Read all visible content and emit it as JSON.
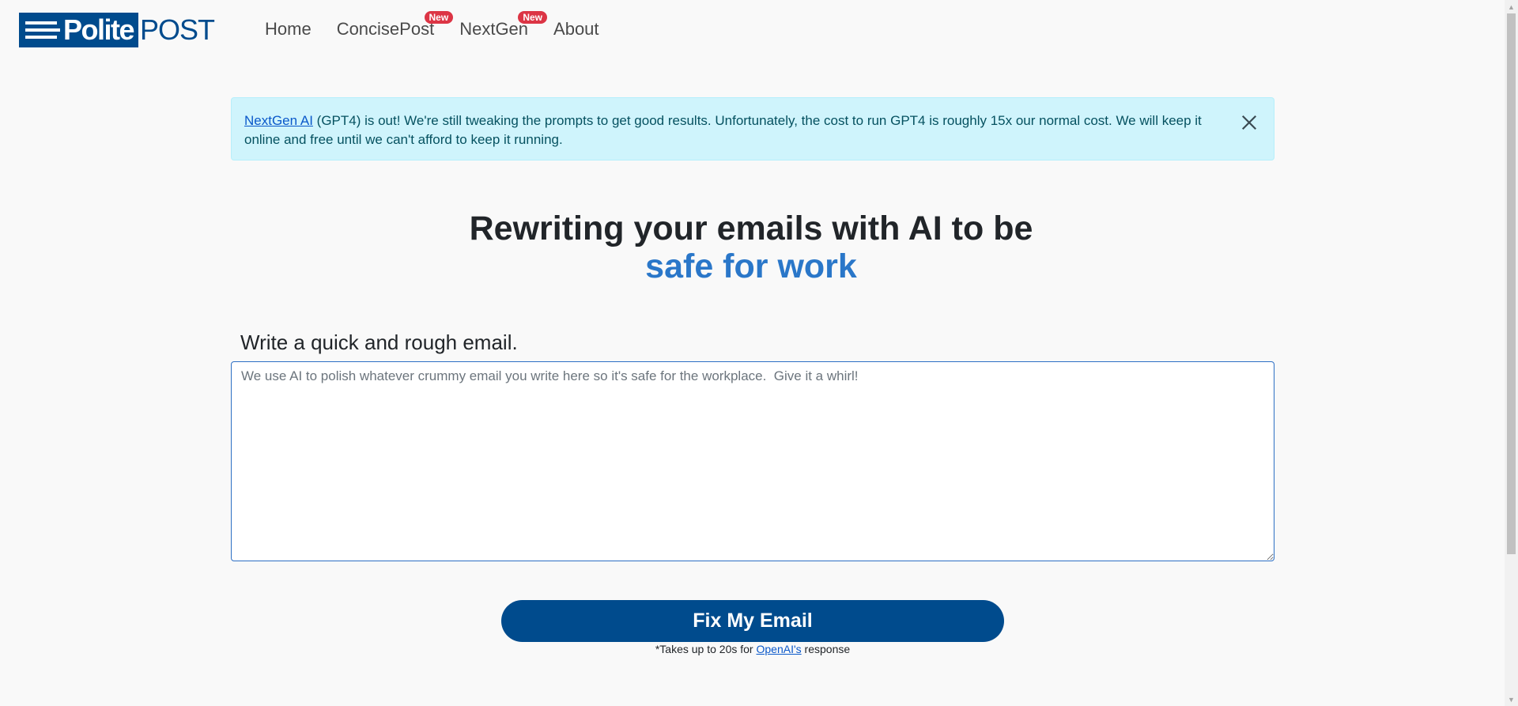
{
  "brand": {
    "logo_left": "Polite",
    "logo_right": "POST"
  },
  "nav": {
    "items": [
      {
        "label": "Home",
        "badge": ""
      },
      {
        "label": "ConcisePost",
        "badge": "New"
      },
      {
        "label": "NextGen",
        "badge": "New"
      },
      {
        "label": "About",
        "badge": ""
      }
    ]
  },
  "alert": {
    "link_text": "NextGen AI",
    "text": " (GPT4) is out! We're still tweaking the prompts to get good results. Unfortunately, the cost to run GPT4 is roughly 15x our normal cost. We will keep it online and free until we can't afford to keep it running."
  },
  "hero": {
    "line1": "Rewriting your emails with AI to be",
    "line2": "safe for work"
  },
  "form": {
    "label": "Write a quick and rough email.",
    "placeholder": "We use AI to polish whatever crummy email you write here so it's safe for the workplace.  Give it a whirl!",
    "value": "",
    "button_label": "Fix My Email"
  },
  "note": {
    "prefix": "*Takes up to 20s for ",
    "link_text": "OpenAI's",
    "suffix": " response"
  },
  "colors": {
    "brand_blue": "#004b8d",
    "accent_blue": "#2a77c9",
    "alert_bg": "#cff4fc",
    "badge_red": "#dc3545"
  }
}
